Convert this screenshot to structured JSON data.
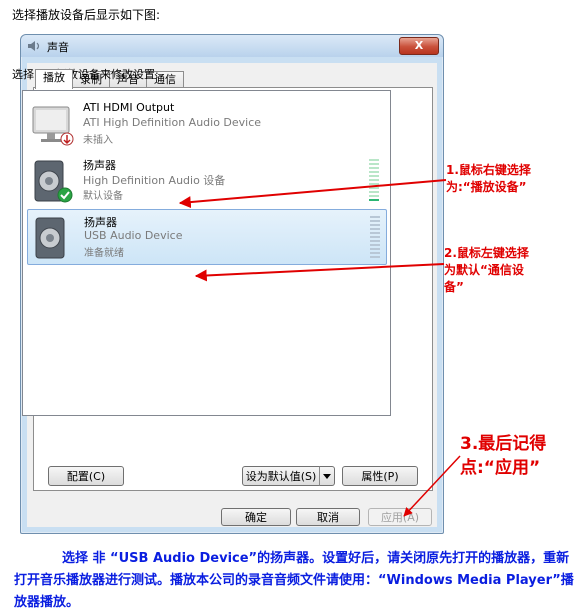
{
  "intro_text": "选择播放设备后显示如下图:",
  "window": {
    "title": "声音",
    "close_label": "X"
  },
  "tabs": [
    {
      "label": "播放",
      "active": true
    },
    {
      "label": "录制",
      "active": false
    },
    {
      "label": "声音",
      "active": false
    },
    {
      "label": "通信",
      "active": false
    }
  ],
  "instruction": "选择以下播放设备来修改设置:",
  "devices": [
    {
      "name": "ATI HDMI Output",
      "description": "ATI High Definition Audio Device",
      "status": "未插入",
      "icon": "hdmi-monitor-icon",
      "badge": "unplugged-arrow"
    },
    {
      "name": "扬声器",
      "description": "High Definition Audio 设备",
      "status": "默认设备",
      "icon": "speaker-icon",
      "badge": "default-check"
    },
    {
      "name": "扬声器",
      "description": "USB Audio Device",
      "status": "准备就绪",
      "icon": "speaker-icon",
      "selected": true
    }
  ],
  "buttons": {
    "configure": "配置(C)",
    "set_default": "设为默认值(S)",
    "properties": "属性(P)",
    "ok": "确定",
    "cancel": "取消",
    "apply": "应用(A)"
  },
  "annotations": {
    "a1_line1": "1.鼠标右键选择",
    "a1_line2": "为:“播放设备”",
    "a2_line1": "2.鼠标左键选择",
    "a2_line2": "为默认“通信设",
    "a2_line3": "备”",
    "a3_line1": "3.最后记得",
    "a3_line2": "点:“应用”"
  },
  "footer": "选择 非 “USB Audio Device”的扬声器。设置好后，请关闭原先打开的播放器，重新打开音乐播放器进行测试。播放本公司的录音音频文件请使用：“Windows Media Player”播放器播放。",
  "colors": {
    "annotation": "#e00000",
    "footer": "#0a1ee0",
    "meter": "#2bb673"
  }
}
